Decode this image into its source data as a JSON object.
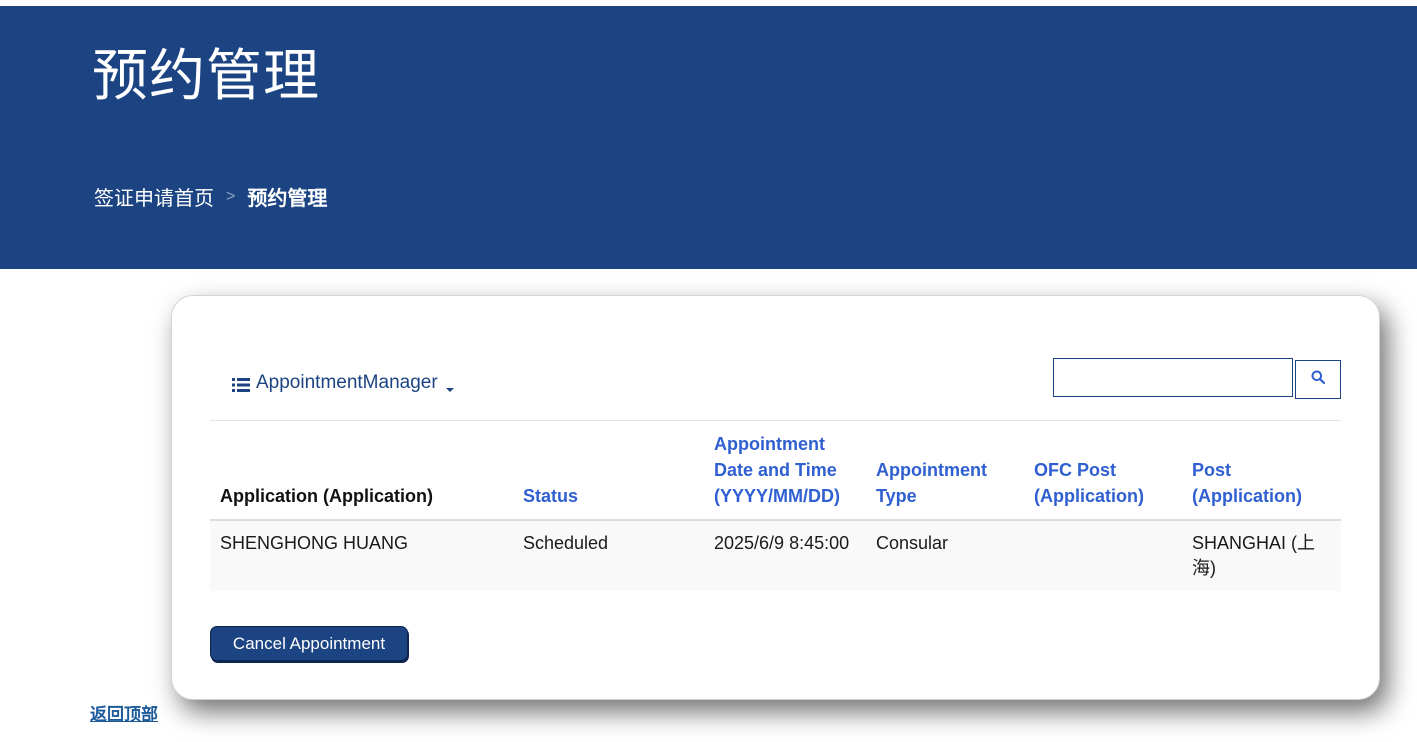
{
  "header": {
    "title": "预约管理",
    "breadcrumb": {
      "home": "签证申请首页",
      "separator": ">",
      "current": "预约管理"
    }
  },
  "toolbar": {
    "view_menu_label": "AppointmentManager",
    "search_placeholder": ""
  },
  "table": {
    "columns": [
      "Application (Application)",
      "Status",
      "Appointment Date and Time (YYYY/MM/DD)",
      "Appointment Type",
      "OFC Post (Application)",
      "Post (Application)"
    ],
    "rows": [
      {
        "application": "SHENGHONG HUANG",
        "status": "Scheduled",
        "date_time": "2025/6/9 8:45:00",
        "type": "Consular",
        "ofc_post": "",
        "post": "SHANGHAI (上海)"
      }
    ]
  },
  "actions": {
    "cancel_label": "Cancel Appointment"
  },
  "footer": {
    "back_to_top": "返回顶部"
  },
  "icons": [
    "list-icon",
    "caret-down-icon",
    "search-icon"
  ],
  "colors": {
    "brand": "#1c4482",
    "link": "#2f5fd0"
  }
}
